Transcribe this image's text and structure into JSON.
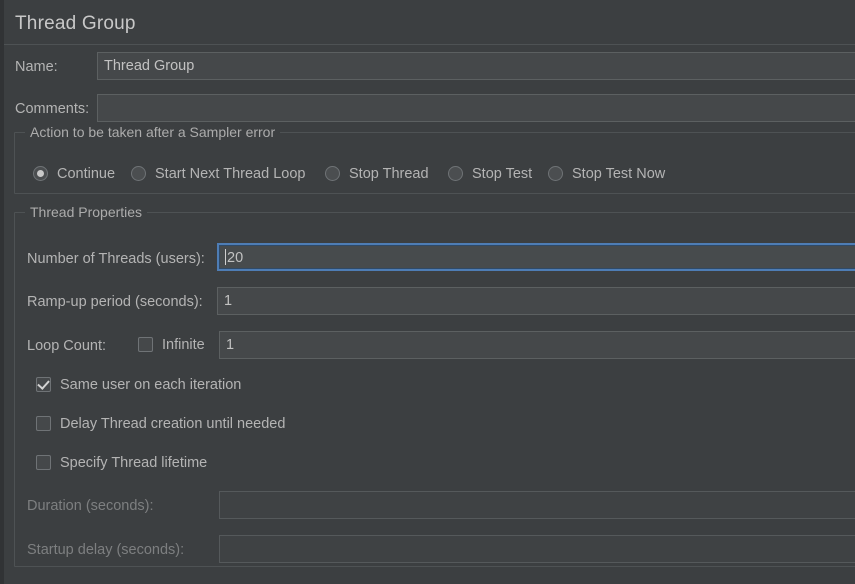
{
  "panel": {
    "title": "Thread Group"
  },
  "name_row": {
    "label": "Name:",
    "value": "Thread Group"
  },
  "comments_row": {
    "label": "Comments:",
    "value": "",
    "placeholder": ""
  },
  "sampler_error_group": {
    "title": "Action to be taken after a Sampler error",
    "selected": "Continue",
    "options": [
      {
        "label": "Continue",
        "selected": true
      },
      {
        "label": "Start Next Thread Loop",
        "selected": false
      },
      {
        "label": "Stop Thread",
        "selected": false
      },
      {
        "label": "Stop Test",
        "selected": false
      },
      {
        "label": "Stop Test Now",
        "selected": false
      }
    ]
  },
  "thread_properties": {
    "title": "Thread Properties",
    "number_of_threads": {
      "label": "Number of Threads (users):",
      "value": "20",
      "focused": true
    },
    "ramp_up": {
      "label": "Ramp-up period (seconds):",
      "value": "1"
    },
    "loop_count": {
      "label": "Loop Count:",
      "infinite_label": "Infinite",
      "infinite_checked": false,
      "value": "1"
    },
    "same_user": {
      "label": "Same user on each iteration",
      "checked": true
    },
    "delay_thread_creation": {
      "label": "Delay Thread creation until needed",
      "checked": false
    },
    "specify_thread_lifetime": {
      "label": "Specify Thread lifetime",
      "checked": false
    },
    "duration": {
      "label": "Duration (seconds):",
      "value": "",
      "disabled": true
    },
    "startup_delay": {
      "label": "Startup delay (seconds):",
      "value": "",
      "disabled": true
    }
  },
  "colors": {
    "background": "#3c3f41",
    "field_background": "#45484a",
    "focus_border": "#4e7db5",
    "text": "#b4b4b4",
    "text_disabled": "#7d7f80",
    "group_border": "#4e5254"
  }
}
